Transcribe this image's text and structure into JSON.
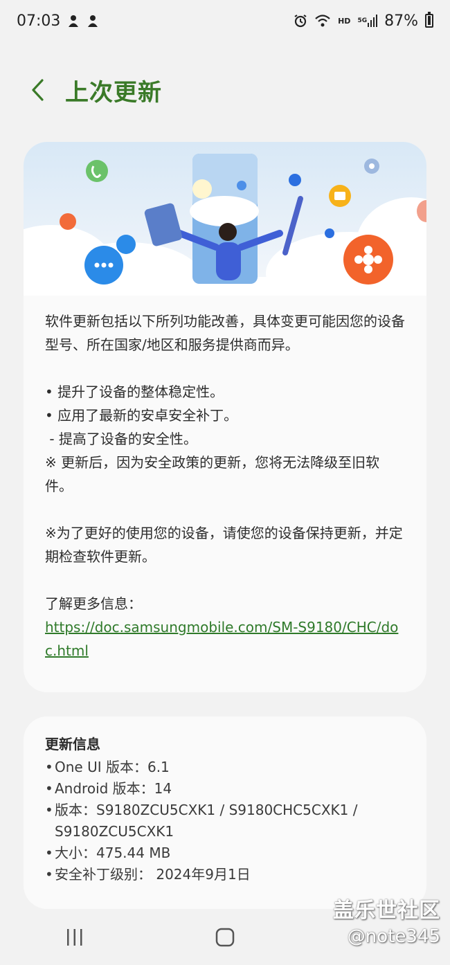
{
  "status_bar": {
    "time": "07:03",
    "network_hd": "HD",
    "network_5g": "5G",
    "battery": "87%"
  },
  "header": {
    "title": "上次更新"
  },
  "release_notes": {
    "intro": "软件更新包括以下所列功能改善，具体变更可能因您的设备型号、所在国家/地区和服务提供商而异。",
    "items": [
      "• 提升了设备的整体稳定性。",
      "• 应用了最新的安卓安全补丁。",
      " - 提高了设备的安全性。",
      "※ 更新后，因为安全政策的更新，您将无法降级至旧软件。"
    ],
    "note": "※为了更好的使用您的设备，请使您的设备保持更新，并定期检查软件更新。",
    "learn_more_label": "了解更多信息：",
    "learn_more_url": "https://doc.samsungmobile.com/SM-S9180/CHC/doc.html"
  },
  "update_info": {
    "title": "更新信息",
    "items": [
      "One UI 版本：6.1",
      "Android 版本：14",
      "版本：S9180ZCU5CXK1 / S9180CHC5CXK1 / S9180ZCU5CXK1",
      "大小：475.44 MB",
      "安全补丁级别： 2024年9月1日"
    ]
  },
  "watermark": {
    "line1": "盖乐世社区",
    "line2": "@note345"
  },
  "colors": {
    "accent_green": "#3a7a28",
    "link_green": "#2f7a2a",
    "background": "#f2f2f2",
    "card": "#fafafa"
  }
}
